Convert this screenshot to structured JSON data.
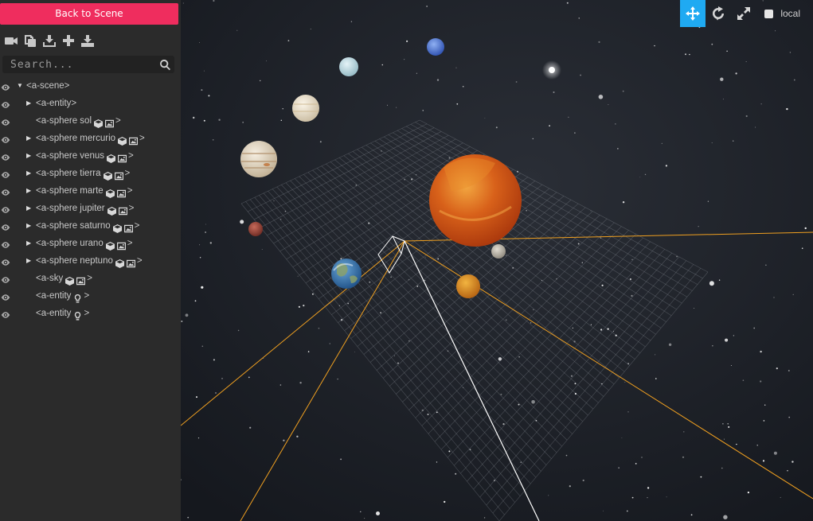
{
  "panel": {
    "back_label": "Back to Scene",
    "toolbar_icons": [
      "video-camera-icon",
      "copy-icon",
      "export-icon",
      "add-entity-icon",
      "download-icon"
    ],
    "search": {
      "placeholder": "Search...",
      "value": ""
    }
  },
  "tree": [
    {
      "depth": 0,
      "caret": "down",
      "text": "<a-scene>",
      "icons": []
    },
    {
      "depth": 1,
      "caret": "right",
      "text": "<a-entity>",
      "icons": []
    },
    {
      "depth": 1,
      "caret": "none",
      "text": "<a-sphere sol",
      "icons": [
        "cube-icon",
        "image-icon"
      ]
    },
    {
      "depth": 1,
      "caret": "right",
      "text": "<a-sphere mercurio",
      "icons": [
        "cube-icon",
        "image-icon"
      ]
    },
    {
      "depth": 1,
      "caret": "right",
      "text": "<a-sphere venus",
      "icons": [
        "cube-icon",
        "image-icon"
      ]
    },
    {
      "depth": 1,
      "caret": "right",
      "text": "<a-sphere tierra",
      "icons": [
        "cube-icon",
        "image-icon"
      ]
    },
    {
      "depth": 1,
      "caret": "right",
      "text": "<a-sphere marte",
      "icons": [
        "cube-icon",
        "image-icon"
      ]
    },
    {
      "depth": 1,
      "caret": "right",
      "text": "<a-sphere jupiter",
      "icons": [
        "cube-icon",
        "image-icon"
      ]
    },
    {
      "depth": 1,
      "caret": "right",
      "text": "<a-sphere saturno",
      "icons": [
        "cube-icon",
        "image-icon"
      ]
    },
    {
      "depth": 1,
      "caret": "right",
      "text": "<a-sphere urano",
      "icons": [
        "cube-icon",
        "image-icon"
      ]
    },
    {
      "depth": 1,
      "caret": "right",
      "text": "<a-sphere neptuno",
      "icons": [
        "cube-icon",
        "image-icon"
      ]
    },
    {
      "depth": 1,
      "caret": "none",
      "text": "<a-sky",
      "icons": [
        "cube-icon",
        "image-icon"
      ]
    },
    {
      "depth": 1,
      "caret": "none",
      "text": "<a-entity",
      "icons": [
        "lightbulb-icon"
      ]
    },
    {
      "depth": 1,
      "caret": "none",
      "text": "<a-entity",
      "icons": [
        "lightbulb-icon"
      ]
    }
  ],
  "viewport_toolbar": {
    "buttons": [
      {
        "name": "translate-icon",
        "active": true
      },
      {
        "name": "rotate-icon",
        "active": false
      },
      {
        "name": "scale-icon",
        "active": false
      }
    ],
    "local_label": "local",
    "local_checked": false
  },
  "colors": {
    "accent": "#ef2d5e",
    "active_tool": "#1faaf2",
    "panel_bg": "#2b2b2b",
    "helper_line": "#f0a020"
  }
}
